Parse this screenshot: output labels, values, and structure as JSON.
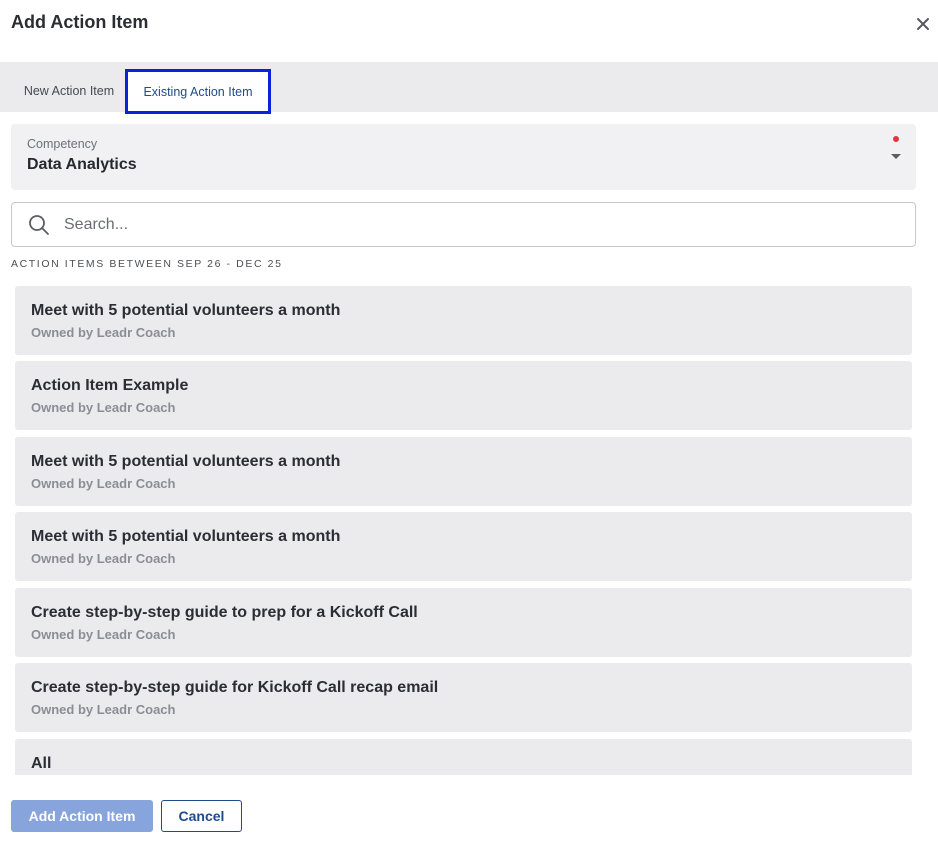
{
  "dialog": {
    "title": "Add Action Item"
  },
  "tabs": [
    {
      "label": "New Action Item",
      "active": false
    },
    {
      "label": "Existing Action Item",
      "active": true
    }
  ],
  "competency": {
    "label": "Competency",
    "value": "Data Analytics",
    "required": true
  },
  "search": {
    "placeholder": "Search..."
  },
  "section_title": "ACTION ITEMS BETWEEN SEP 26 - DEC 25",
  "items": [
    {
      "title": "Meet with 5 potential volunteers a month",
      "owner": "Owned by Leadr Coach"
    },
    {
      "title": "Action Item Example",
      "owner": "Owned by Leadr Coach"
    },
    {
      "title": "Meet with 5 potential volunteers a month",
      "owner": "Owned by Leadr Coach"
    },
    {
      "title": "Meet with 5 potential volunteers a month",
      "owner": "Owned by Leadr Coach"
    },
    {
      "title": "Create step-by-step guide to prep for a Kickoff Call",
      "owner": "Owned by Leadr Coach"
    },
    {
      "title": "Create step-by-step guide for Kickoff Call recap email",
      "owner": "Owned by Leadr Coach"
    },
    {
      "title": "All",
      "owner": ""
    }
  ],
  "footer": {
    "primary_label": "Add Action Item",
    "secondary_label": "Cancel"
  },
  "colors": {
    "accent": "#1f4a8c",
    "primary_disabled": "#87a5dc",
    "required_dot": "#e5353b",
    "focus_outline": "#0a22d8"
  }
}
